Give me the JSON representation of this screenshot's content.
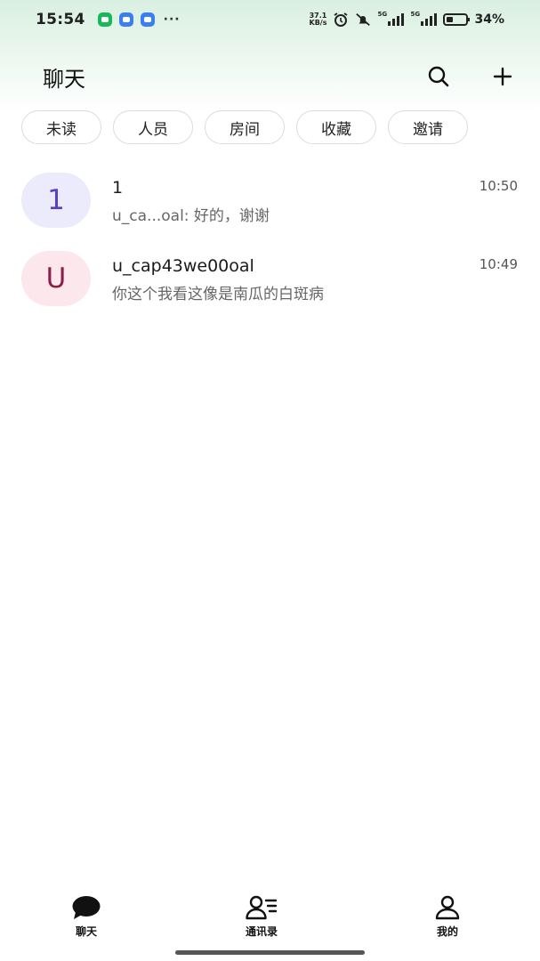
{
  "status_bar": {
    "time": "15:54",
    "net_speed_value": "37.1",
    "net_speed_unit": "KB/s",
    "sim1_tag": "5G",
    "sim2_tag": "5G",
    "battery": "34%",
    "notif_colors": [
      "#19b95a",
      "#3a7ef0",
      "#3a7ef0"
    ],
    "more": "···"
  },
  "header": {
    "title": "聊天",
    "search_icon": "search-icon",
    "add_icon": "plus-icon"
  },
  "filters": [
    "未读",
    "人员",
    "房间",
    "收藏",
    "邀请"
  ],
  "chats": [
    {
      "avatar_letter": "1",
      "avatar_bg": "#ecebfb",
      "avatar_color": "#5b3fc4",
      "name": "1",
      "preview": "u_ca...oal: 好的，谢谢",
      "time": "10:50"
    },
    {
      "avatar_letter": "U",
      "avatar_bg": "#fbe7ec",
      "avatar_color": "#8c1c4a",
      "name": "u_cap43we00oal",
      "preview": "你这个我看这像是南瓜的白斑病",
      "time": "10:49"
    }
  ],
  "bottom_nav": {
    "chats": "聊天",
    "contacts": "通讯录",
    "me": "我的"
  }
}
